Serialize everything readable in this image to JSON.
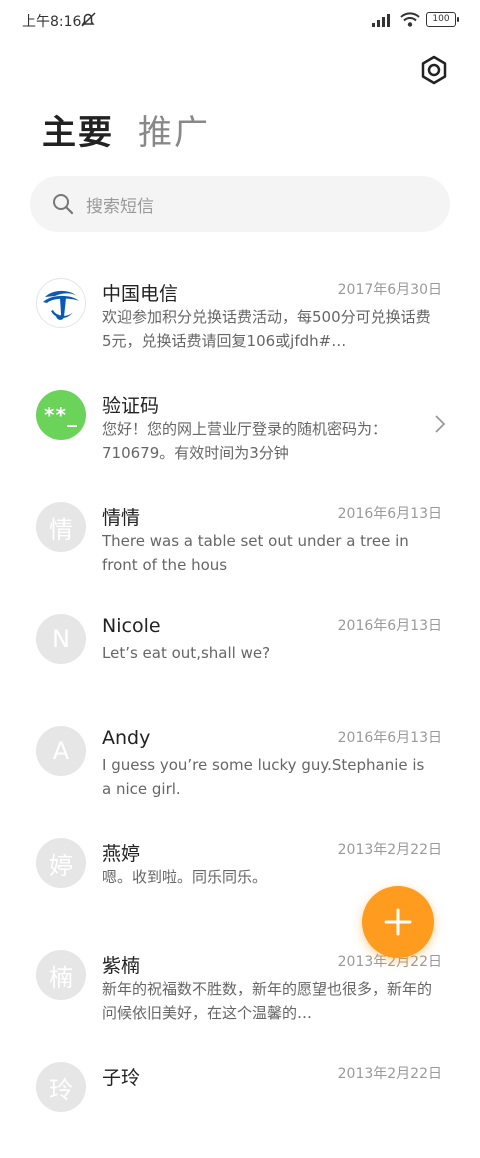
{
  "status_bar": {
    "time": "上午8:16",
    "battery": "100",
    "icons": [
      "alarm-off-icon",
      "signal-icon",
      "wifi-icon",
      "battery-icon"
    ]
  },
  "header": {
    "settings_icon": "gear-icon",
    "tabs": [
      {
        "label": "主要",
        "active": true
      },
      {
        "label": "推广",
        "active": false
      }
    ]
  },
  "search": {
    "placeholder": "搜索短信",
    "icon": "search-icon"
  },
  "messages": [
    {
      "avatar": "",
      "avatar_type": "telecom-logo",
      "name": "中国电信",
      "date": "2017年6月30日",
      "preview": "欢迎参加积分兑换话费活动，每500分可兑换话费5元，兑换话费请回复106或jfdh#…"
    },
    {
      "avatar": "**_",
      "avatar_type": "green",
      "name": "验证码",
      "date": "",
      "preview": "您好！您的网上营业厅登录的随机密码为：710679。有效时间为3分钟"
    },
    {
      "avatar": "情",
      "avatar_type": "letter",
      "name": "情情",
      "date": "2016年6月13日",
      "preview": "There was a table set out under a tree in front of the hous"
    },
    {
      "avatar": "N",
      "avatar_type": "letter",
      "name": "Nicole",
      "date": "2016年6月13日",
      "preview": "Let’s eat out,shall we?"
    },
    {
      "avatar": "A",
      "avatar_type": "letter",
      "name": "Andy",
      "date": "2016年6月13日",
      "preview": "I guess you’re some lucky guy.Stephanie is a nice girl."
    },
    {
      "avatar": "婷",
      "avatar_type": "letter",
      "name": "燕婷",
      "date": "2013年2月22日",
      "preview": "嗯。收到啦。同乐同乐。"
    },
    {
      "avatar": "楠",
      "avatar_type": "letter",
      "name": "紫楠",
      "date": "2013年2月22日",
      "preview": "新年的祝福数不胜数，新年的愿望也很多，新年的问候依旧美好，在这个温馨的…"
    },
    {
      "avatar": "玲",
      "avatar_type": "letter",
      "name": "子玲",
      "date": "2013年2月22日",
      "preview": ""
    }
  ],
  "fab": {
    "label": "+",
    "icon": "plus-icon"
  },
  "colors": {
    "accent": "#ff9b1e",
    "verify_green": "#6bd35a",
    "telecom_blue": "#0a5ab5"
  }
}
